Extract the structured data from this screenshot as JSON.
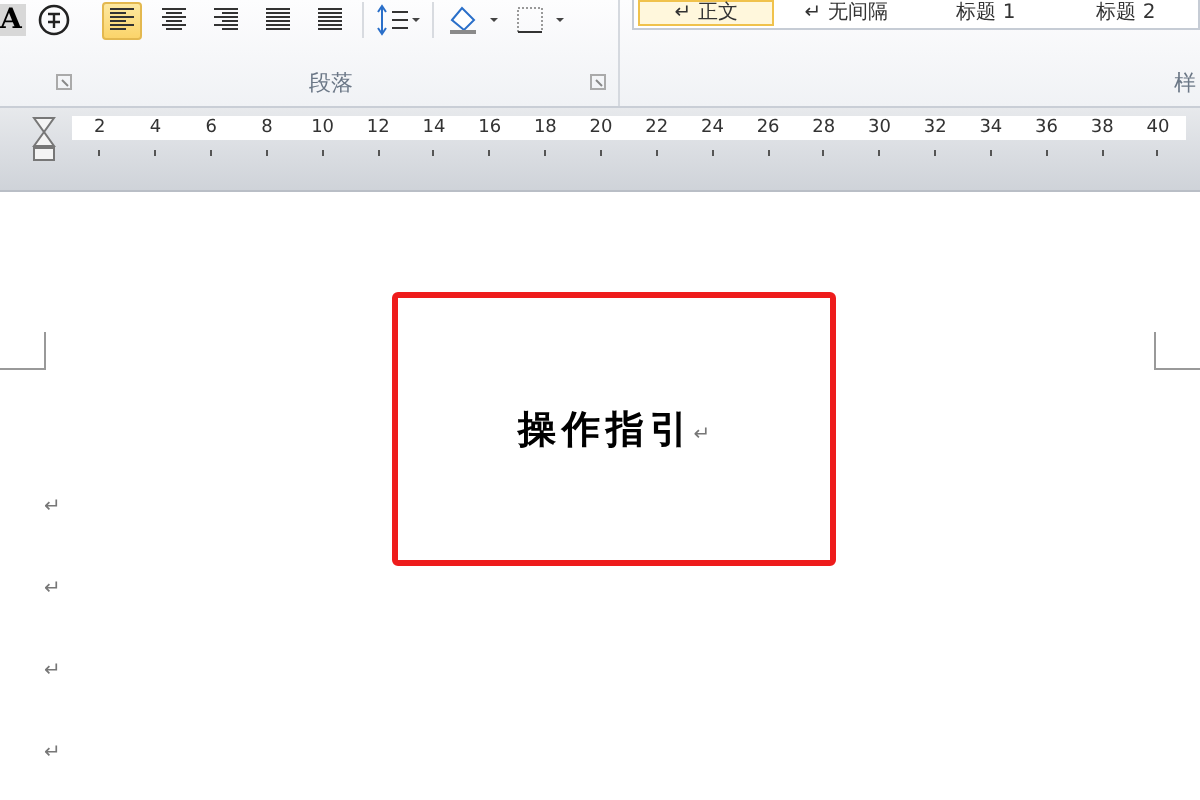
{
  "ribbon": {
    "font_group_glyph": "A",
    "paragraph_group": {
      "align_buttons": [
        {
          "kind": "left",
          "selected": true
        },
        {
          "kind": "center",
          "selected": false
        },
        {
          "kind": "right",
          "selected": false
        },
        {
          "kind": "justify",
          "selected": false
        },
        {
          "kind": "distributed",
          "selected": false
        }
      ],
      "label": "段落"
    },
    "styles_group": {
      "items": [
        {
          "label": "↵ 正文",
          "selected": true
        },
        {
          "label": "↵ 无间隔",
          "selected": false
        },
        {
          "label": "标题 1",
          "selected": false
        },
        {
          "label": "标题 2",
          "selected": false
        }
      ],
      "label": "样"
    }
  },
  "ruler": {
    "labels": [
      "2",
      "4",
      "6",
      "8",
      "10",
      "12",
      "14",
      "16",
      "18",
      "20",
      "22",
      "24",
      "26",
      "28",
      "30",
      "32",
      "34",
      "36",
      "38",
      "40"
    ]
  },
  "document": {
    "title": "操作指引",
    "title_mark": "↵",
    "paragraph_marks": [
      "↵",
      "↵",
      "↵",
      "↵"
    ]
  }
}
